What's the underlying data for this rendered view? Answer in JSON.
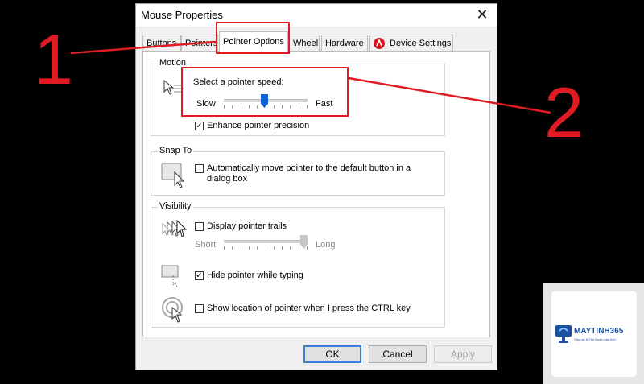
{
  "dialog": {
    "title": "Mouse Properties",
    "close_glyph": "✕",
    "tabs": [
      {
        "label": "Buttons"
      },
      {
        "label": "Pointers"
      },
      {
        "label": "Pointer Options"
      },
      {
        "label": "Wheel"
      },
      {
        "label": "Hardware"
      },
      {
        "label": "Device Settings"
      }
    ],
    "motion": {
      "group_label": "Motion",
      "speed_label": "Select a pointer speed:",
      "slow_label": "Slow",
      "fast_label": "Fast",
      "speed_value_fraction": 0.48,
      "precision_label": "Enhance pointer precision",
      "precision_checked": true
    },
    "snap_to": {
      "group_label": "Snap To",
      "checkbox_label_line1": "Automatically move pointer to the default button in a",
      "checkbox_label_line2": "dialog box",
      "checked": false
    },
    "visibility": {
      "group_label": "Visibility",
      "trails_label": "Display pointer trails",
      "trails_checked": false,
      "short_label": "Short",
      "long_label": "Long",
      "trails_value_fraction": 1.0,
      "hide_label": "Hide pointer while typing",
      "hide_checked": true,
      "ctrl_label": "Show location of pointer when I press the CTRL key",
      "ctrl_checked": false
    },
    "buttons": {
      "ok": "OK",
      "cancel": "Cancel",
      "apply": "Apply"
    }
  },
  "annotations": {
    "number_1": "1",
    "number_2": "2",
    "color": "#e01b24"
  },
  "watermark": {
    "brand": "MAYTINH365",
    "tagline": "Chia sẻ & Thủ thuật máy tính"
  }
}
